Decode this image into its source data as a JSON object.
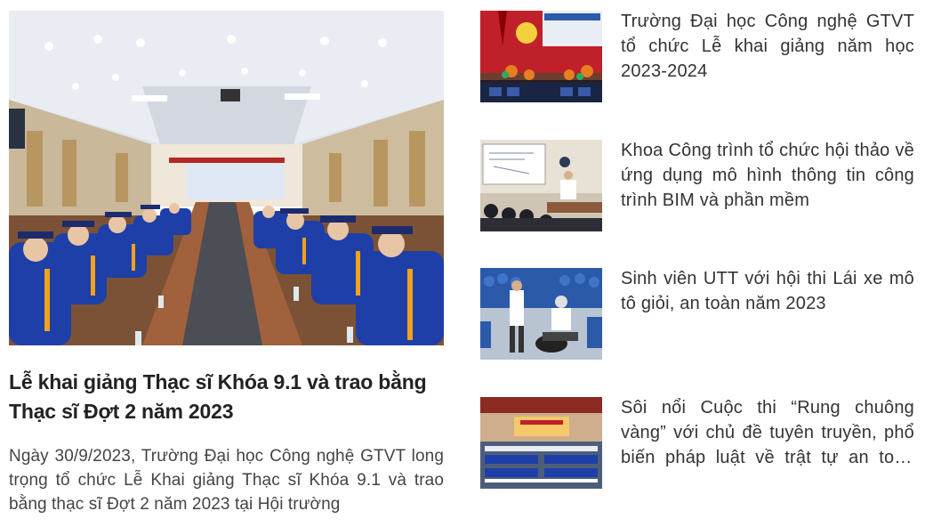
{
  "featured": {
    "image_alt": "Hội trường lễ khai giảng",
    "title": "Lễ khai giảng Thạc sĩ Khóa 9.1 và trao bằng Thạc sĩ Đợt 2 năm 2023",
    "excerpt": "Ngày 30/9/2023, Trường Đại học Công nghệ GTVT long trọng tổ chức Lễ Khai giảng Thạc sĩ Khóa 9.1 và trao bằng thạc sĩ Đợt 2 năm 2023 tại Hội trường"
  },
  "news": [
    {
      "title": "Trường Đại học Công nghệ GTVT tổ chức Lễ khai giảng năm học 2023-2024"
    },
    {
      "title": "Khoa Công trình tổ chức hội thảo về ứng dụng mô hình thông tin công trình BIM và phần mềm"
    },
    {
      "title": "Sinh viên UTT với hội thi Lái xe mô tô giỏi, an toàn năm 2023"
    },
    {
      "title": "Sôi nổi Cuộc thi “Rung chuông vàng” với chủ đề tuyên truyền, phổ biến pháp luật về trật tự an toàn giao thông"
    }
  ],
  "colors": {
    "gown_blue": "#1f3fa8",
    "gown_trim": "#f5a21b",
    "stage_red": "#c0202a",
    "table_wood": "#8a4a2a"
  }
}
